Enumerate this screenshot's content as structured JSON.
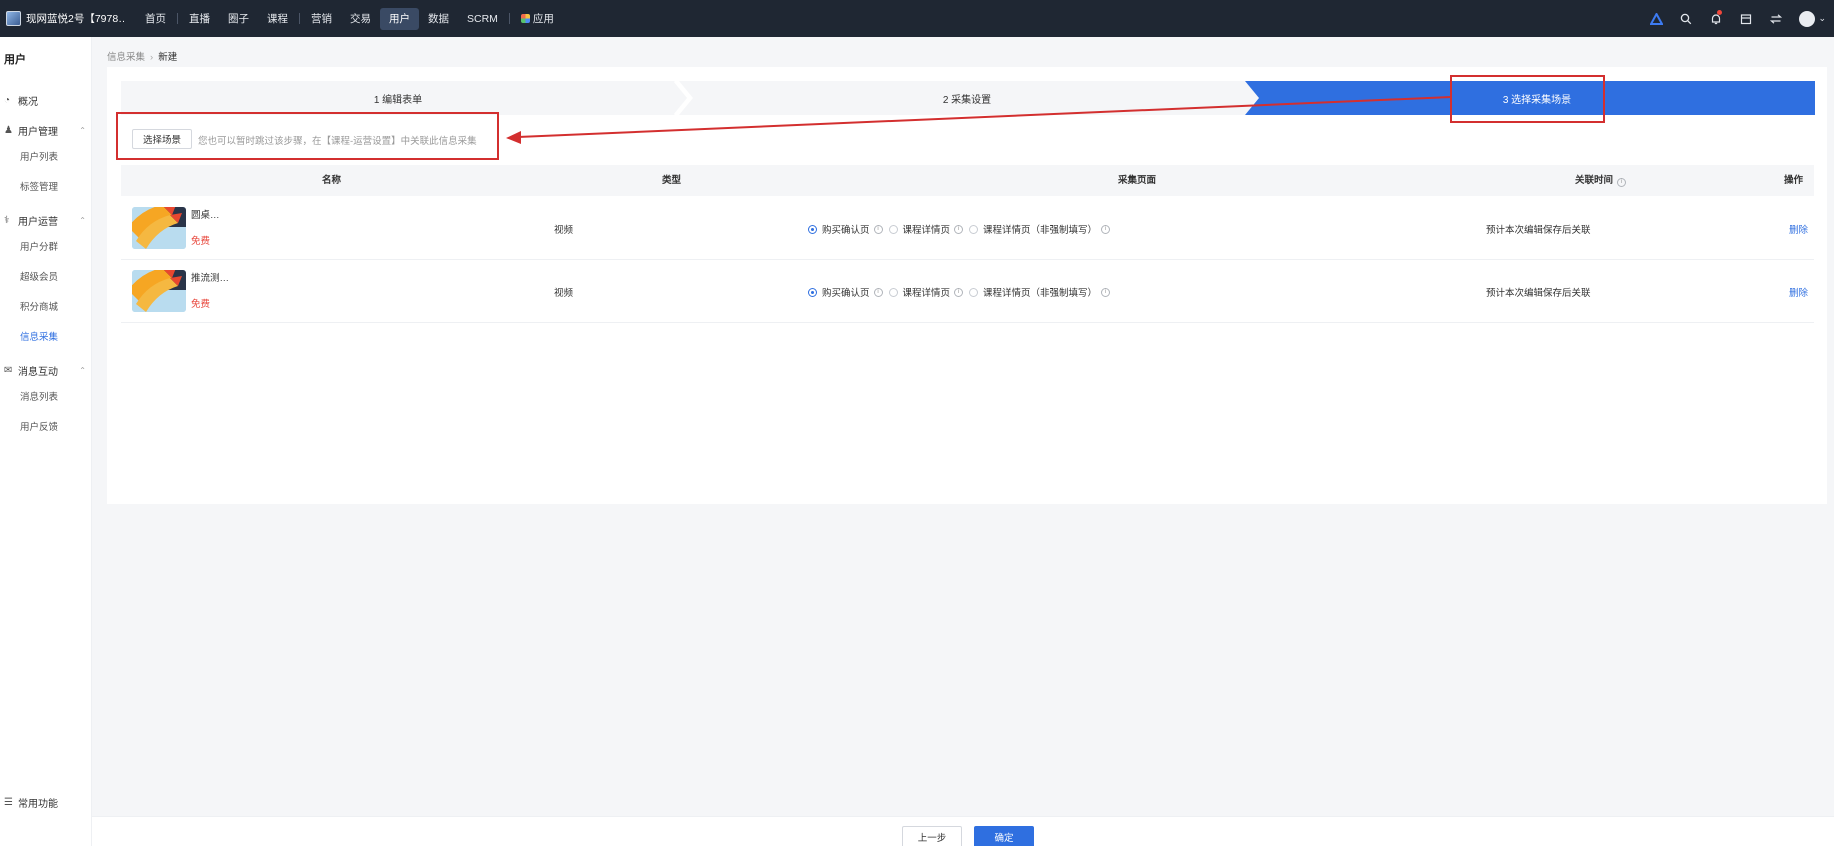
{
  "topbar": {
    "brand_name": "现网蓝悦2号【7978…",
    "nav": [
      "首页",
      "直播",
      "圈子",
      "课程",
      "营销",
      "交易",
      "用户",
      "数据",
      "SCRM",
      "应用"
    ],
    "active_nav": "用户"
  },
  "sidebar": {
    "title": "用户",
    "overview": "概况",
    "groups": [
      {
        "label": "用户管理",
        "icon": "user-manage-icon",
        "items": [
          "用户列表",
          "标签管理"
        ]
      },
      {
        "label": "用户运营",
        "icon": "user-ops-icon",
        "items": [
          "用户分群",
          "超级会员",
          "积分商城",
          "信息采集"
        ]
      },
      {
        "label": "消息互动",
        "icon": "message-icon",
        "items": [
          "消息列表",
          "用户反馈"
        ]
      }
    ],
    "active_item": "信息采集",
    "bottom": "常用功能"
  },
  "breadcrumb": {
    "parent": "信息采集",
    "current": "新建"
  },
  "steps": [
    {
      "label": "1 编辑表单",
      "active": false
    },
    {
      "label": "2 采集设置",
      "active": false
    },
    {
      "label": "3 选择采集场景",
      "active": true
    }
  ],
  "scene": {
    "button_label": "选择场景",
    "hint": "您也可以暂时跳过该步骤，在【课程-运营设置】中关联此信息采集"
  },
  "table": {
    "headers": {
      "name": "名称",
      "type": "类型",
      "page": "采集页面",
      "time": "关联时间",
      "action": "操作"
    },
    "rows": [
      {
        "name": "圆桌…",
        "price": "免费",
        "type": "视频",
        "options": [
          "购买确认页",
          "课程详情页",
          "课程详情页（非强制填写）"
        ],
        "selected": 0,
        "time": "预计本次编辑保存后关联",
        "action": "删除"
      },
      {
        "name": "推流测…",
        "price": "免费",
        "type": "视频",
        "options": [
          "购买确认页",
          "课程详情页",
          "课程详情页（非强制填写）"
        ],
        "selected": 0,
        "time": "预计本次编辑保存后关联",
        "action": "删除"
      }
    ]
  },
  "footer": {
    "prev": "上一步",
    "confirm": "确定"
  },
  "colors": {
    "accent": "#2f6fe0",
    "annotation": "#d32f2f",
    "topbar": "#1f2733"
  }
}
